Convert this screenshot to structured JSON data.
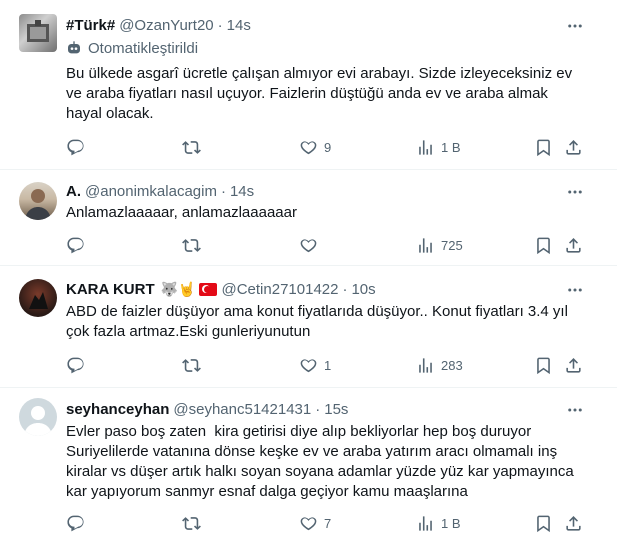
{
  "tweets": [
    {
      "name": "#Türk#",
      "handle": "@OzanYurt20",
      "time": "14s",
      "automated_label": "Otomatikleştirildi",
      "text": "Bu ülkede asgarî ücretle çalışan almıyor evi arabayı. Sizde izleyeceksiniz ev ve araba fiyatları nasıl uçuyor. Faizlerin düştüğü anda ev ve araba almak hayal olacak.",
      "replies": "",
      "retweets": "",
      "likes": "9",
      "views": "1 B"
    },
    {
      "name": "A.",
      "handle": "@anonimkalacagim",
      "time": "14s",
      "text": "Anlamazlaaaaar, anlamazlaaaaaar",
      "replies": "",
      "retweets": "",
      "likes": "",
      "views": "725"
    },
    {
      "name": "KARA KURT",
      "name_emoji": "🐺🤘",
      "handle": "@Cetin27101422",
      "time": "10s",
      "text": "ABD de faizler düşüyor ama konut fiyatlarıda düşüyor.. Konut fiyatları 3.4 yıl çok fazla artmaz.Eski gunleriyunutun",
      "replies": "",
      "retweets": "",
      "likes": "1",
      "views": "283"
    },
    {
      "name": "seyhanceyhan",
      "handle": "@seyhanc51421431",
      "time": "15s",
      "text": "Evler paso boş zaten  kira getirisi diye alıp bekliyorlar hep boş duruyor Suriyelilerde vatanına dönse keşke ev ve araba yatırım aracı olmamalı inş kiralar vs düşer artık halkı soyan soyana adamlar yüzde yüz kar yapmayınca kar yapıyorum sanmyr esnaf dalga geçiyor kamu maaşlarına",
      "replies": "",
      "retweets": "",
      "likes": "7",
      "views": "1 B"
    }
  ],
  "colors": {
    "text": "#0f1419",
    "secondary": "#536471",
    "divider": "#eff3f4"
  },
  "icons": [
    "reply-icon",
    "retweet-icon",
    "like-icon",
    "views-icon",
    "bookmark-icon",
    "share-icon",
    "more-icon",
    "robot-icon"
  ]
}
